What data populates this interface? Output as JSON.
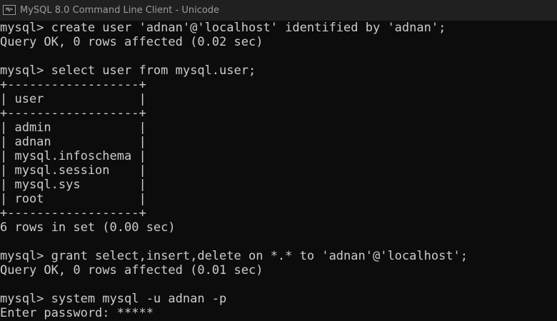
{
  "window": {
    "title": "MySQL 8.0 Command Line Client - Unicode",
    "icon": "mysql-console-icon",
    "icon_text": "My>"
  },
  "colors": {
    "background": "#0c0c0c",
    "text": "#cccccc",
    "titlebar": "#202020",
    "title_text": "#9c9c9c"
  },
  "console": {
    "lines": [
      "mysql> create user 'adnan'@'localhost' identified by 'adnan';",
      "Query OK, 0 rows affected (0.02 sec)",
      "",
      "mysql> select user from mysql.user;",
      "+------------------+",
      "| user             |",
      "+------------------+",
      "| admin            |",
      "| adnan            |",
      "| mysql.infoschema |",
      "| mysql.session    |",
      "| mysql.sys        |",
      "| root             |",
      "+------------------+",
      "6 rows in set (0.00 sec)",
      "",
      "mysql> grant select,insert,delete on *.* to 'adnan'@'localhost';",
      "Query OK, 0 rows affected (0.01 sec)",
      "",
      "mysql> system mysql -u adnan -p",
      "Enter password: *****"
    ]
  }
}
